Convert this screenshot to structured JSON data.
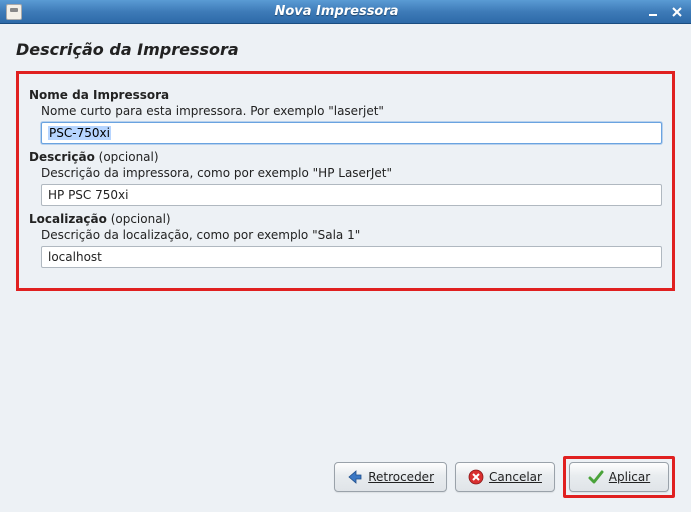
{
  "window": {
    "title": "Nova Impressora"
  },
  "page": {
    "title": "Descrição da Impressora"
  },
  "sections": {
    "name": {
      "label_bold": "Nome da Impressora",
      "help": "Nome curto para esta impressora. Por exemplo \"laserjet\"",
      "value": "PSC-750xi"
    },
    "description": {
      "label_bold": "Descrição",
      "label_extra": " (opcional)",
      "help": "Descrição da impressora, como por exemplo \"HP LaserJet\"",
      "value": "HP PSC 750xi"
    },
    "location": {
      "label_bold": "Localização",
      "label_extra": " (opcional)",
      "help": "Descrição da localização, como por exemplo \"Sala 1\"",
      "value": "localhost"
    }
  },
  "buttons": {
    "back": "Retroceder",
    "cancel": "Cancelar",
    "apply": "Aplicar"
  }
}
